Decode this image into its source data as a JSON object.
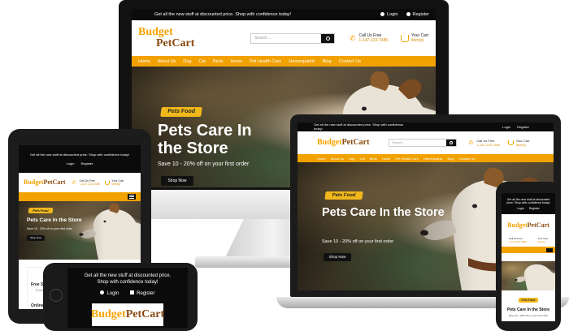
{
  "brand": {
    "logo_budget": "Budget",
    "logo_petcart": "PetCart",
    "accent": "#f1a100",
    "dark": "#0b0b0b"
  },
  "topbar": {
    "promo": "Get all the new stuff at discounted price. Shop with confidence today!",
    "promo_line1": "Get all the new stuff at discounted price.",
    "promo_line2": "Shop with confidence today!",
    "login": "Login",
    "register": "Register"
  },
  "header": {
    "search_placeholder": "Search ...",
    "call_label": "Call Us Free",
    "call_number": "1-147-123-7485",
    "cart_label": "Your Cart",
    "cart_items": "item(s)"
  },
  "nav": [
    "Home",
    "About Us",
    "Dog",
    "Cat",
    "Birds",
    "Horse",
    "Pet Health Care",
    "Homeopathic",
    "Blog",
    "Contact Us"
  ],
  "hero": {
    "tag": "Pets Food",
    "title": "Pets Care In the Store",
    "title_line1": "Pets Care In",
    "title_line2": "the Store",
    "subtitle": "Save 10 - 20% off on your first order",
    "button": "Shop Now"
  },
  "features": {
    "free_shipping": "Free Shipping",
    "free_shipping_sub": "From $99.00",
    "online_support": "Online Support"
  }
}
